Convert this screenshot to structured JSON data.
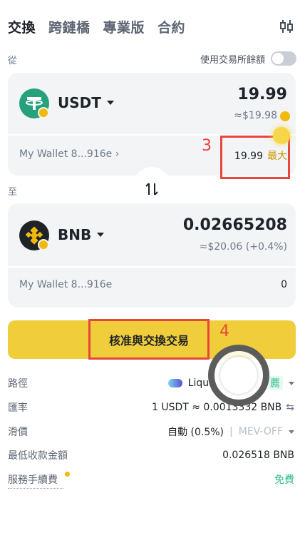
{
  "tabs": [
    {
      "label": "交換",
      "active": true
    },
    {
      "label": "跨鏈橋",
      "active": false
    },
    {
      "label": "專業版",
      "active": false
    },
    {
      "label": "合約",
      "active": false
    }
  ],
  "header": {
    "settings_icon": "sliders-icon"
  },
  "from": {
    "section_label": "從",
    "use_balance_label": "使用交易所餘額",
    "use_balance_enabled": false,
    "coin": "USDT",
    "amount": "19.99",
    "fiat": "≈$19.98",
    "wallet": "My Wallet 8...916e",
    "balance": "19.99",
    "max_label": "最大"
  },
  "to": {
    "section_label": "至",
    "coin": "BNB",
    "amount": "0.02665208",
    "fiat": "≈$20.06 (+0.4%)",
    "wallet": "My Wallet 8...916e",
    "balance": "0"
  },
  "action": {
    "approve_swap_label": "核准與交換交易"
  },
  "annotations": {
    "step3": "3",
    "step4": "4"
  },
  "details": {
    "route_label": "路徑",
    "route_value": "Liqui",
    "route_tag": "薦",
    "rate_label": "匯率",
    "rate_value": "1 USDT ≈ 0.0013332 BNB",
    "slippage_label": "滑價",
    "slippage_value": "自動 (0.5%)",
    "mev_value": "MEV-OFF",
    "min_received_label": "最低收款金額",
    "min_received_value": "0.026518 BNB",
    "fee_label": "服務手續費",
    "fee_value": "免費"
  },
  "colors": {
    "accent": "#f0cd3a",
    "usdt": "#26a17b",
    "bnb": "#f0b90b",
    "annotation": "#e8453c",
    "free": "#2ebd85"
  }
}
